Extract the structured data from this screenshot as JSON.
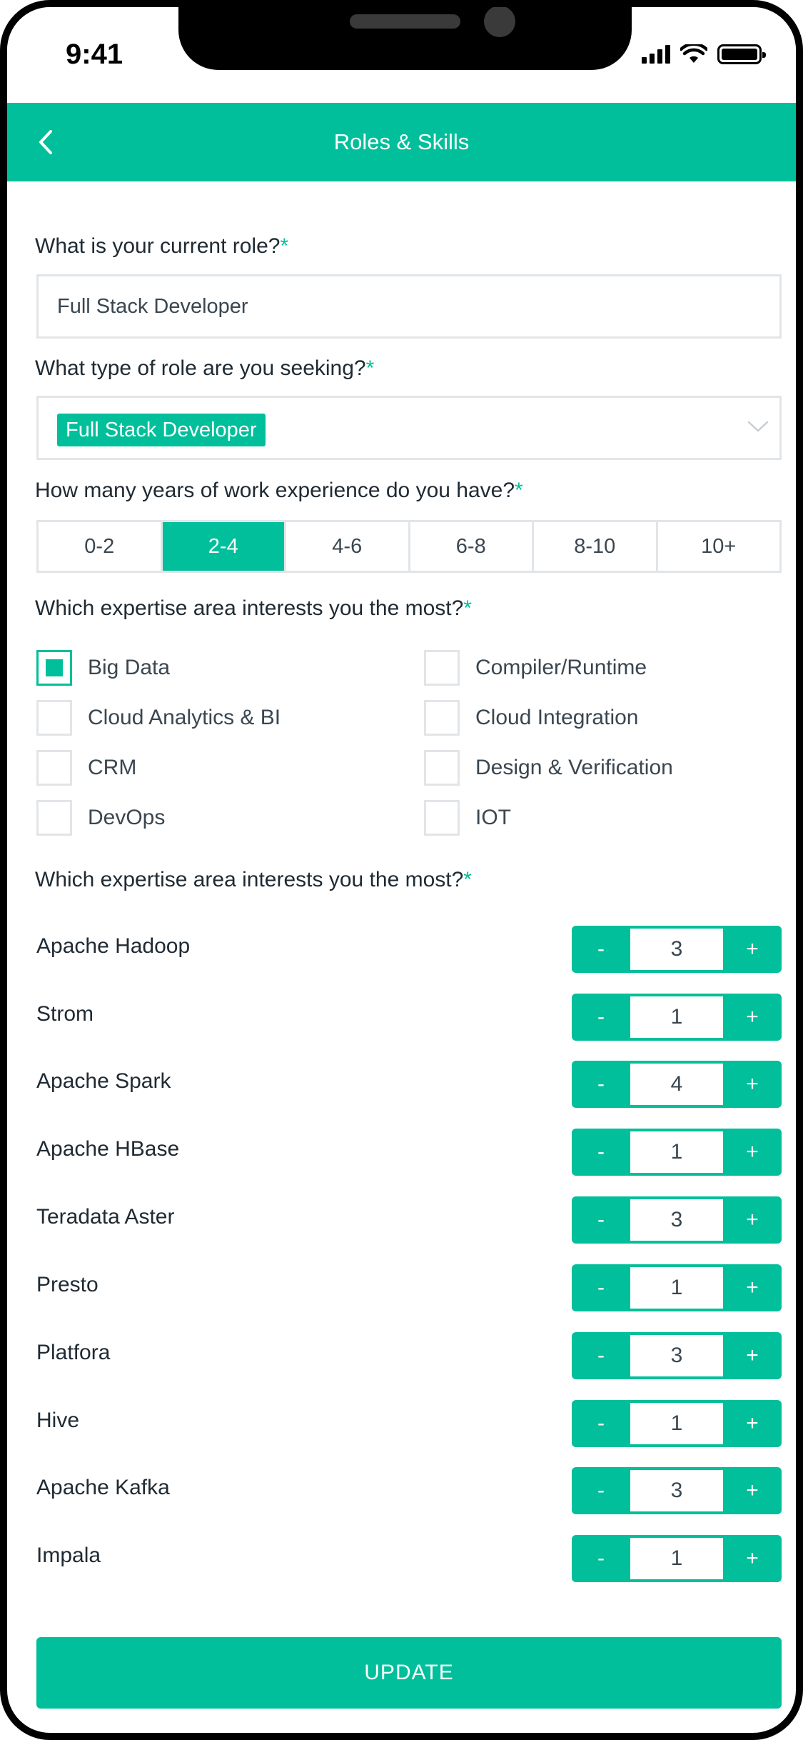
{
  "status": {
    "time": "9:41"
  },
  "header": {
    "title": "Roles & Skills"
  },
  "form": {
    "current_role": {
      "label": "What is your current role?",
      "required_mark": "*",
      "value": "Full Stack Developer"
    },
    "seeking_role": {
      "label": "What type of role are you seeking?",
      "required_mark": "*",
      "selected": "Full Stack Developer"
    },
    "experience": {
      "label": "How many years of work experience do you have?",
      "required_mark": "*",
      "options": [
        "0-2",
        "2-4",
        "4-6",
        "6-8",
        "8-10",
        "10+"
      ],
      "selected": "2-4"
    },
    "expertise_area": {
      "label": "Which expertise area interests you the most?",
      "required_mark": "*",
      "options": [
        {
          "label": "Big Data",
          "checked": true
        },
        {
          "label": "Compiler/Runtime",
          "checked": false
        },
        {
          "label": "Cloud Analytics & BI",
          "checked": false
        },
        {
          "label": "Cloud Integration",
          "checked": false
        },
        {
          "label": "CRM",
          "checked": false
        },
        {
          "label": "Design & Verification",
          "checked": false
        },
        {
          "label": "DevOps",
          "checked": false
        },
        {
          "label": "IOT",
          "checked": false
        }
      ]
    },
    "skills": {
      "label": "Which expertise area interests you the most?",
      "required_mark": "*",
      "minus_label": "-",
      "plus_label": "+",
      "items": [
        {
          "name": "Apache Hadoop",
          "value": "3"
        },
        {
          "name": "Strom",
          "value": "1"
        },
        {
          "name": "Apache Spark",
          "value": "4"
        },
        {
          "name": "Apache HBase",
          "value": "1"
        },
        {
          "name": "Teradata Aster",
          "value": "3"
        },
        {
          "name": "Presto",
          "value": "1"
        },
        {
          "name": "Platfora",
          "value": "3"
        },
        {
          "name": "Hive",
          "value": "1"
        },
        {
          "name": "Apache Kafka",
          "value": "3"
        },
        {
          "name": "Impala",
          "value": "1"
        }
      ]
    },
    "update_label": "UPDATE"
  },
  "colors": {
    "accent": "#00bf9a",
    "border": "#e2e5e8",
    "text": "#1f2a33"
  },
  "icons": {
    "back": "chevron-left-icon",
    "dropdown": "chevron-down-icon"
  }
}
